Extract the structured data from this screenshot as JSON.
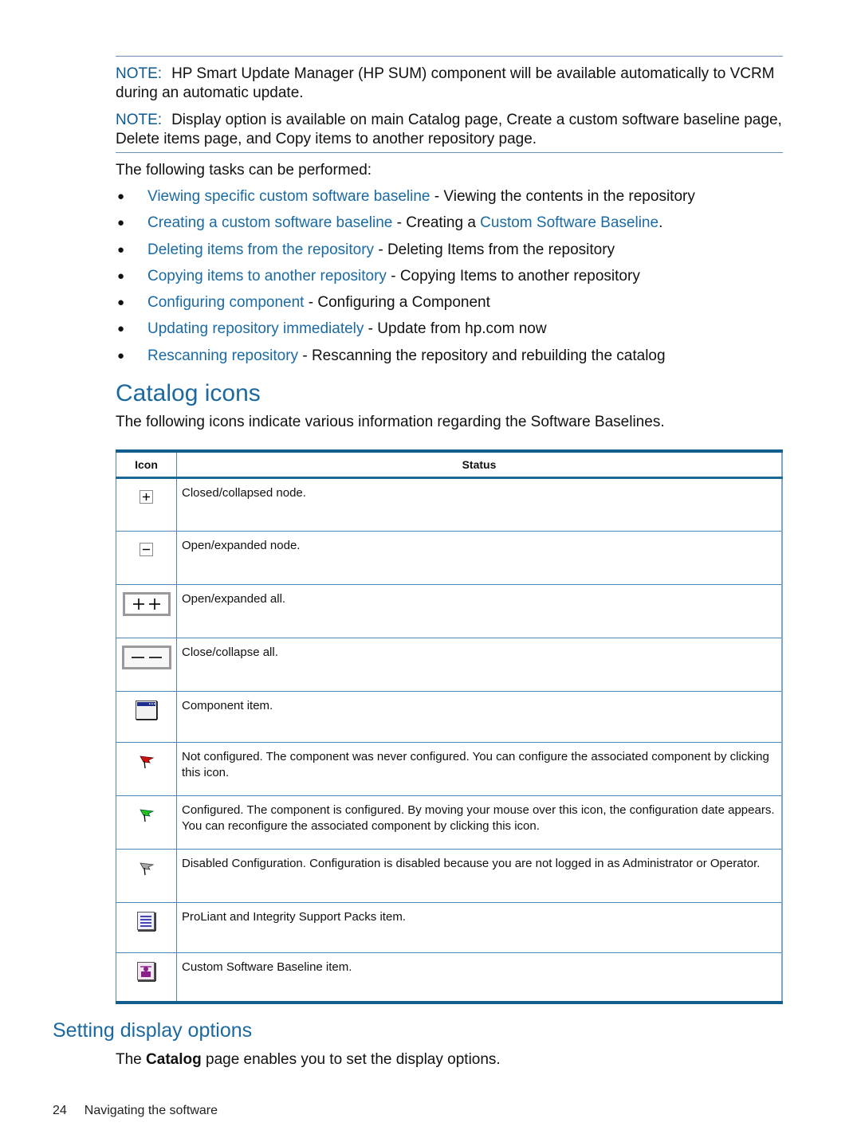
{
  "notes": [
    {
      "label": "NOTE:",
      "text": "HP Smart Update Manager (HP SUM) component will be available automatically to VCRM during an automatic update."
    },
    {
      "label": "NOTE:",
      "text": "Display option is available on main Catalog page, Create a custom software baseline page, Delete items page, and Copy items to another repository page."
    }
  ],
  "tasks_intro": "The following tasks can be performed:",
  "tasks": [
    {
      "link": "Viewing specific custom software baseline",
      "sep": " - ",
      "desc": "Viewing the contents in the repository",
      "desc_link": "",
      "tail": ""
    },
    {
      "link": "Creating a custom software baseline",
      "sep": " - ",
      "desc": "Creating a ",
      "desc_link": "Custom Software Baseline",
      "tail": "."
    },
    {
      "link": "Deleting items from the repository",
      "sep": " - ",
      "desc": "Deleting Items from the repository",
      "desc_link": "",
      "tail": ""
    },
    {
      "link": "Copying items to another repository",
      "sep": " - ",
      "desc": "Copying Items to another repository",
      "desc_link": "",
      "tail": ""
    },
    {
      "link": "Configuring component",
      "sep": " - ",
      "desc": "Configuring a Component",
      "desc_link": "",
      "tail": ""
    },
    {
      "link": "Updating repository immediately",
      "sep": " - ",
      "desc": "Update from hp.com now",
      "desc_link": "",
      "tail": ""
    },
    {
      "link": "Rescanning repository",
      "sep": " - ",
      "desc": "Rescanning the repository and rebuilding the catalog",
      "desc_link": "",
      "tail": ""
    }
  ],
  "catalog_icons": {
    "heading": "Catalog icons",
    "intro": "The following icons indicate various information regarding the Software Baselines.",
    "columns": [
      "Icon",
      "Status"
    ],
    "rows": [
      {
        "icon": "plus-box-icon",
        "status": "Closed/collapsed node."
      },
      {
        "icon": "minus-box-icon",
        "status": "Open/expanded node."
      },
      {
        "icon": "expand-all-icon",
        "status": "Open/expanded all."
      },
      {
        "icon": "collapse-all-icon",
        "status": "Close/collapse all."
      },
      {
        "icon": "component-window-icon",
        "status": "Component item."
      },
      {
        "icon": "red-flag-icon",
        "status": "Not configured. The component was never configured. You can configure the associated component by clicking this icon."
      },
      {
        "icon": "green-flag-icon",
        "status": "Configured. The component is configured. By moving your mouse over this icon, the configuration date appears. You can reconfigure the associated component by clicking this icon."
      },
      {
        "icon": "gray-flag-icon",
        "status": "Disabled Configuration. Configuration is disabled because you are not logged in as Administrator or Operator."
      },
      {
        "icon": "support-pack-icon",
        "status": "ProLiant and Integrity Support Packs item."
      },
      {
        "icon": "custom-baseline-icon",
        "status": "Custom Software Baseline item."
      }
    ]
  },
  "display_options": {
    "heading": "Setting display options",
    "text_before": "The ",
    "text_bold": "Catalog",
    "text_after": " page enables you to set the display options."
  },
  "footer": {
    "page_number": "24",
    "section": "Navigating the software"
  },
  "colors": {
    "link": "#1a6aa3",
    "heading": "#1c69a0",
    "note_label": "#0d5a8c",
    "rule": "#135d8f"
  }
}
